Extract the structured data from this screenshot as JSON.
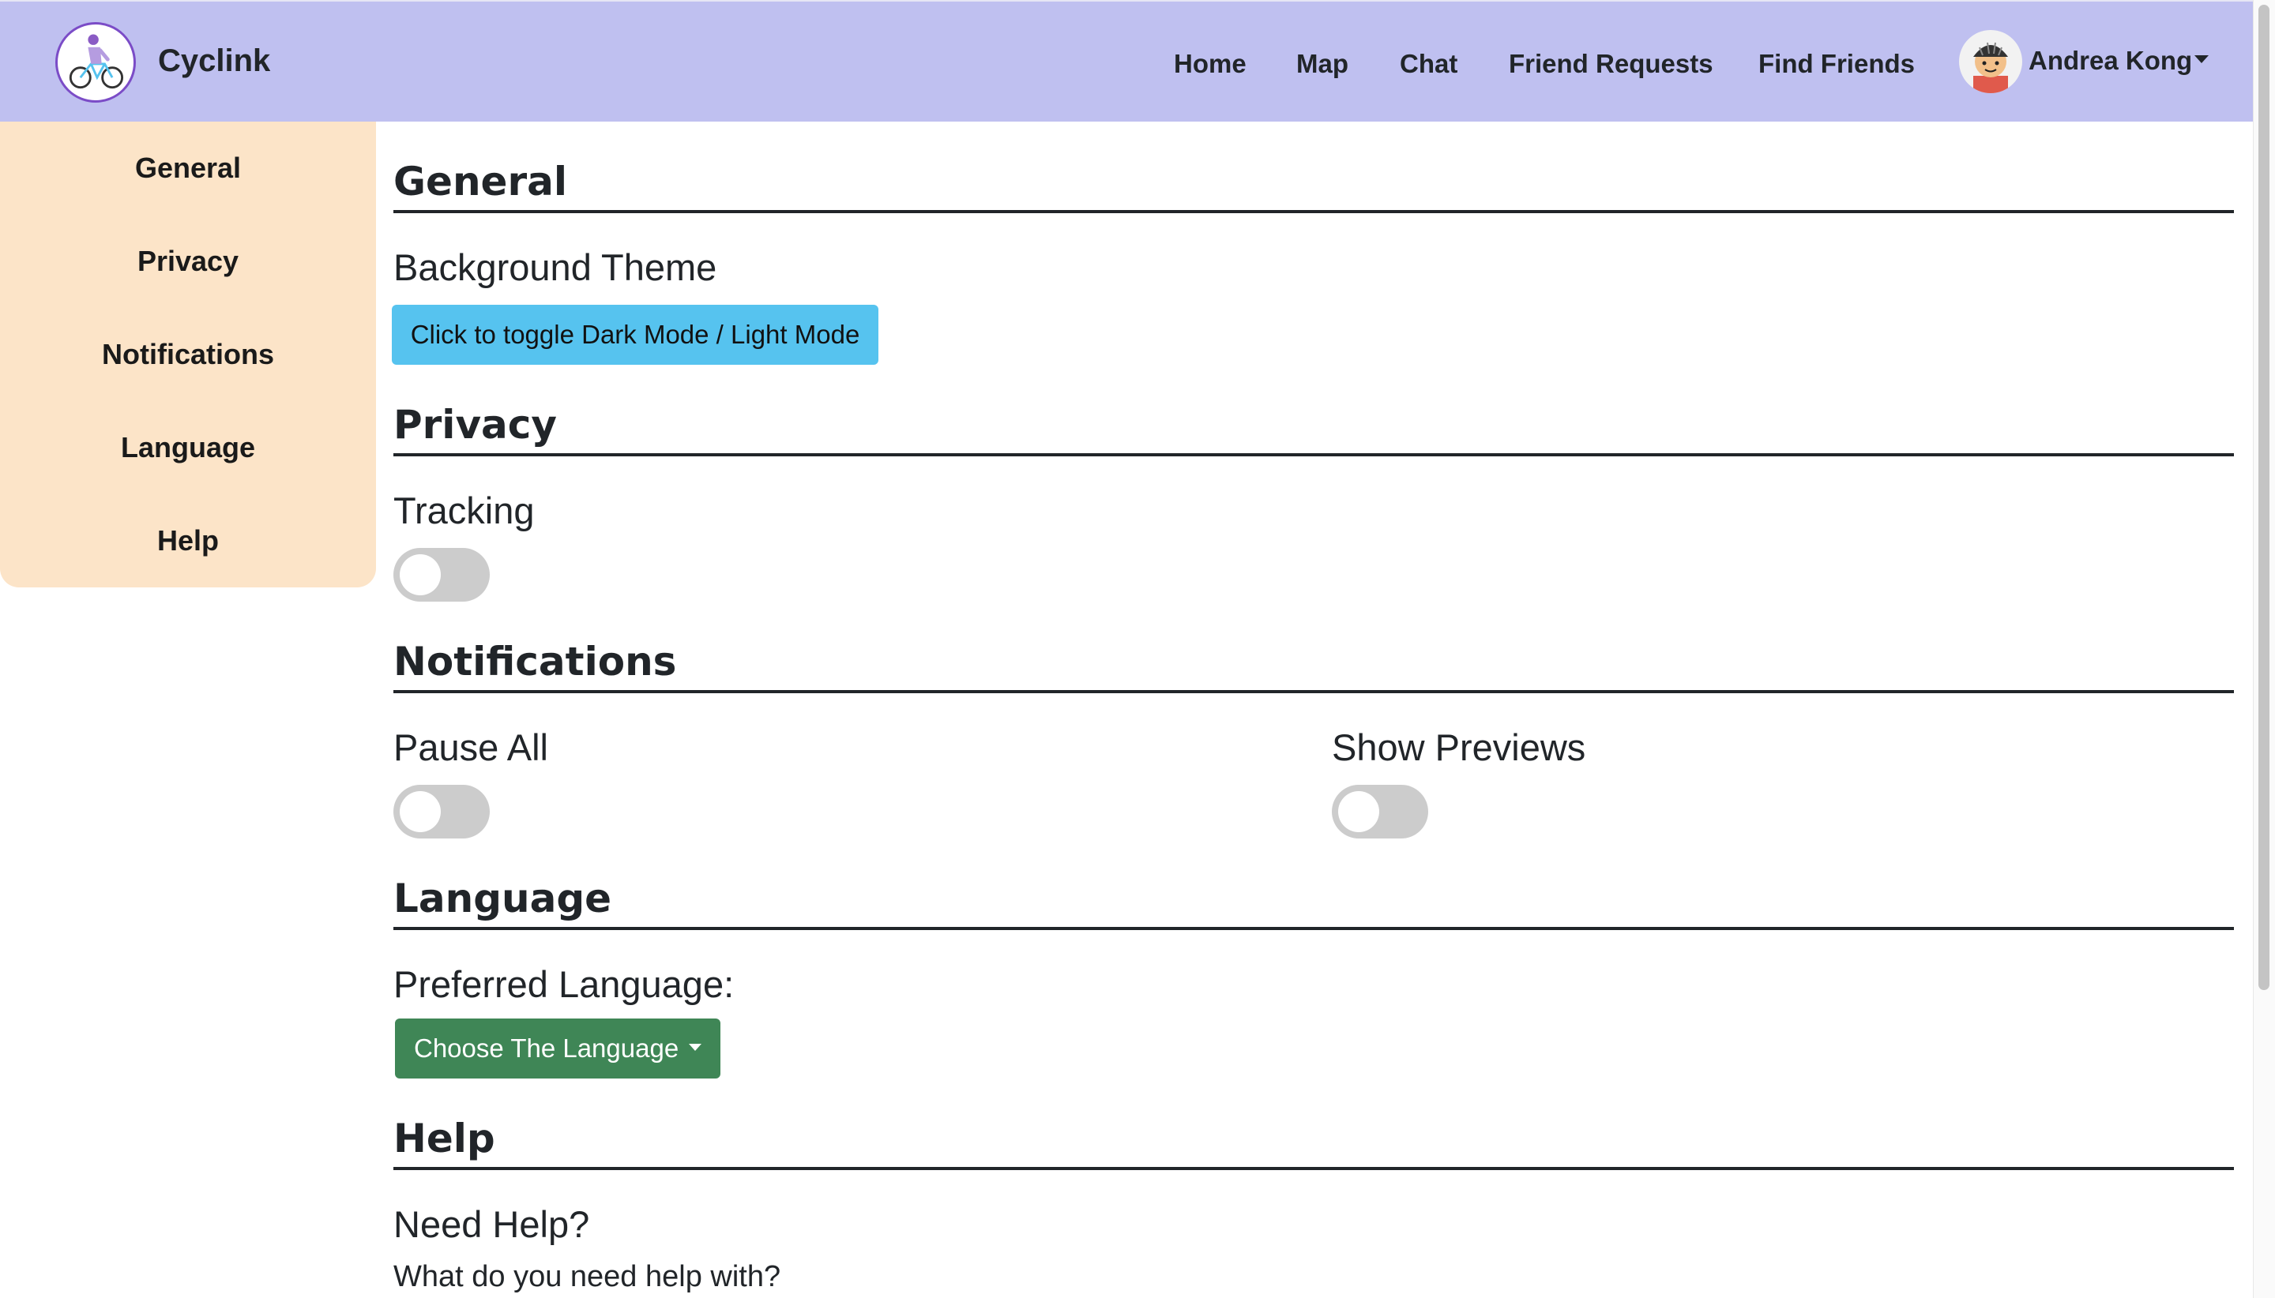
{
  "navbar": {
    "brand": "Cyclink",
    "links": [
      "Home",
      "Map",
      "Chat",
      "Friend Requests",
      "Find Friends"
    ],
    "user_name": "Andrea Kong"
  },
  "sidebar": {
    "items": [
      "General",
      "Privacy",
      "Notifications",
      "Language",
      "Help"
    ]
  },
  "general": {
    "title": "General",
    "background_theme_label": "Background Theme",
    "toggle_button_label": "Click to toggle Dark Mode / Light Mode"
  },
  "privacy": {
    "title": "Privacy",
    "tracking_label": "Tracking",
    "tracking_on": false
  },
  "notifications": {
    "title": "Notifications",
    "pause_all_label": "Pause All",
    "pause_all_on": false,
    "show_previews_label": "Show Previews",
    "show_previews_on": false
  },
  "language": {
    "title": "Language",
    "preferred_label": "Preferred Language:",
    "dropdown_label": "Choose The Language"
  },
  "help": {
    "title": "Help",
    "need_help_label": "Need Help?",
    "question_text": "What do you need help with?"
  },
  "colors": {
    "navbar_bg": "#bfc0f0",
    "sidebar_bg": "#fce4c8",
    "theme_button": "#56c3ef",
    "language_button": "#3f8656",
    "toggle_off": "#cccccc"
  }
}
